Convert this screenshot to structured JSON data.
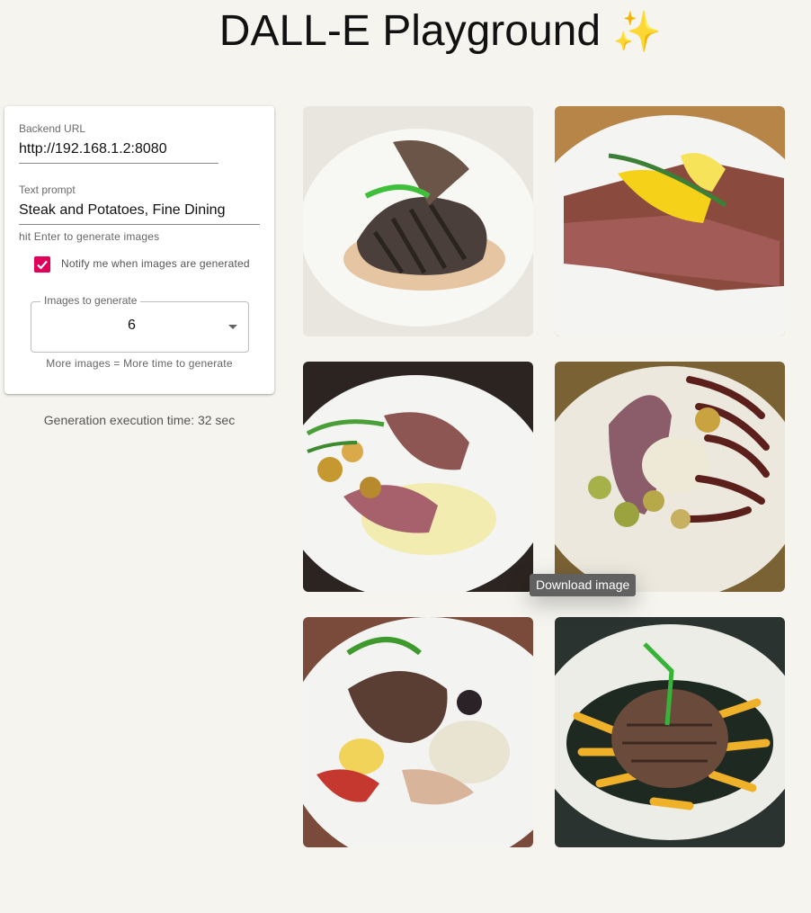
{
  "header": {
    "title": "DALL-E Playground",
    "sparkle_icon": "sparkles-icon"
  },
  "panel": {
    "backend": {
      "label": "Backend URL",
      "value": "http://192.168.1.2:8080"
    },
    "prompt": {
      "label": "Text prompt",
      "value": "Steak and Potatoes, Fine Dining",
      "helper": "hit Enter to generate images"
    },
    "notify": {
      "label": "Notify me when images are generated",
      "checked": true
    },
    "images": {
      "label": "Images to generate",
      "value": "6",
      "helper": "More images = More time to generate"
    }
  },
  "status": {
    "exec_time": "Generation execution time: 32 sec"
  },
  "gallery": {
    "tooltip": "Download image",
    "images": [
      {
        "name": "steak-image-1"
      },
      {
        "name": "steak-image-2"
      },
      {
        "name": "steak-image-3"
      },
      {
        "name": "steak-image-4"
      },
      {
        "name": "steak-image-5"
      },
      {
        "name": "steak-image-6"
      }
    ]
  },
  "colors": {
    "accent": "#e0005a",
    "background": "#f5f4ee",
    "tooltip_bg": "#616161"
  }
}
